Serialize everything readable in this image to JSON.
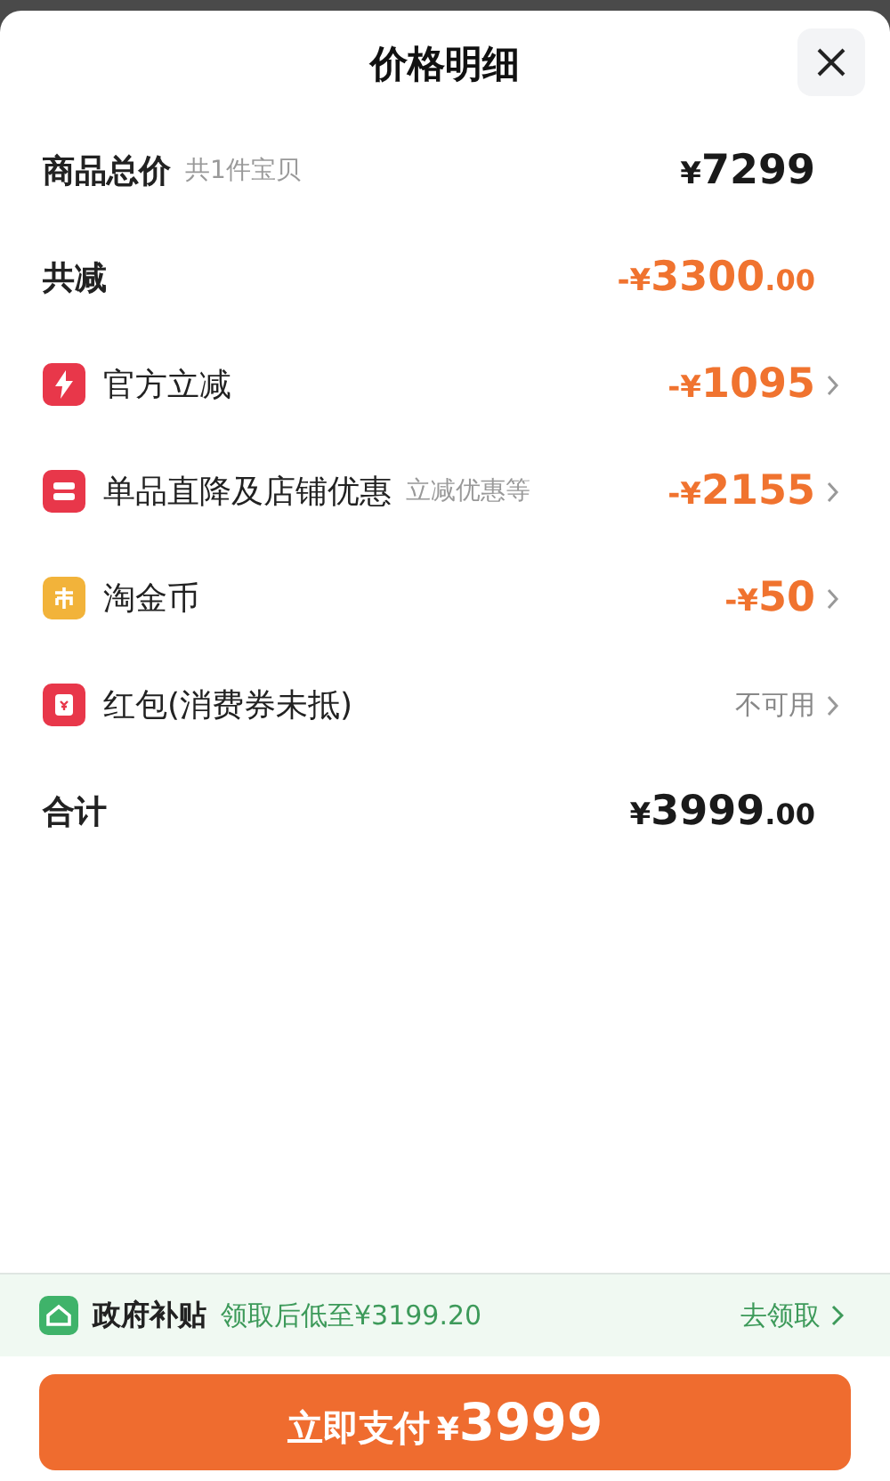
{
  "header": {
    "title": "价格明细"
  },
  "rows": [
    {
      "kind": "total",
      "label": "商品总价",
      "note": "共1件宝贝",
      "amount": {
        "prefix": "¥",
        "main": "7299"
      }
    },
    {
      "kind": "reduction",
      "label": "共减",
      "amount": {
        "prefix": "-¥",
        "main": "3300",
        "cents": ".00"
      }
    },
    {
      "kind": "item",
      "label": "官方立减",
      "amount": {
        "prefix": "-¥",
        "main": "1095"
      }
    },
    {
      "kind": "item",
      "label": "单品直降及店铺优惠",
      "note": "立减优惠等",
      "amount": {
        "prefix": "-¥",
        "main": "2155"
      }
    },
    {
      "kind": "item",
      "label": "淘金币",
      "amount": {
        "prefix": "-¥",
        "main": "50"
      }
    },
    {
      "kind": "item",
      "label": "红包(消费券未抵)",
      "status": "不可用"
    },
    {
      "kind": "total",
      "label": "合计",
      "amount": {
        "prefix": "¥",
        "main": "3999",
        "cents": ".00"
      }
    }
  ],
  "subsidy": {
    "label": "政府补贴",
    "detail": "领取后低至¥3199.20",
    "action": "去领取"
  },
  "pay_button": {
    "label": "立即支付",
    "prefix": "¥",
    "amount": "3999"
  }
}
